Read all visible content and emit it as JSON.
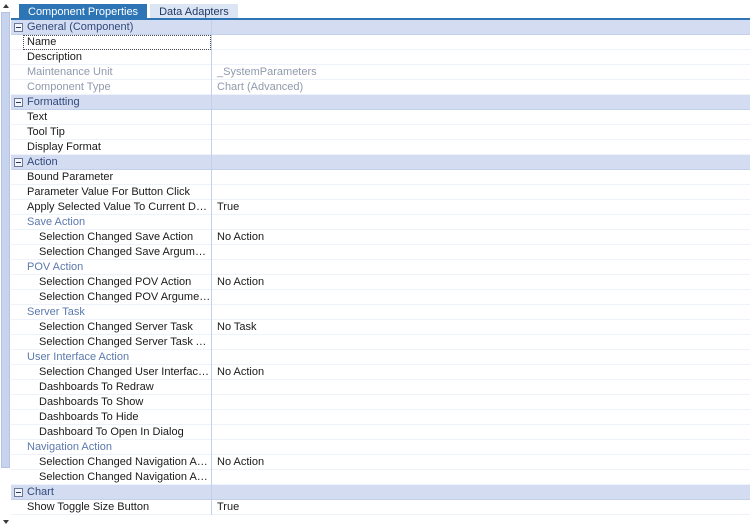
{
  "tabs": [
    {
      "label": "Component Properties",
      "active": true
    },
    {
      "label": "Data Adapters",
      "active": false
    }
  ],
  "scrollbar": {
    "up_arrow": "scroll-up-arrow",
    "down_arrow": "scroll-down-arrow"
  },
  "grid": {
    "rows": [
      {
        "type": "group",
        "label": "General (Component)",
        "value": "",
        "indent": 0,
        "expanded": true
      },
      {
        "type": "prop",
        "label": "Name",
        "value": "",
        "indent": 1,
        "focused": true
      },
      {
        "type": "prop",
        "label": "Description",
        "value": "",
        "indent": 1
      },
      {
        "type": "prop",
        "label": "Maintenance Unit",
        "value": "_SystemParameters",
        "indent": 1,
        "readonly": true
      },
      {
        "type": "prop",
        "label": "Component Type",
        "value": "Chart (Advanced)",
        "indent": 1,
        "readonly": true
      },
      {
        "type": "group",
        "label": "Formatting",
        "value": "",
        "indent": 0,
        "expanded": true
      },
      {
        "type": "prop",
        "label": "Text",
        "value": "",
        "indent": 1
      },
      {
        "type": "prop",
        "label": "Tool Tip",
        "value": "",
        "indent": 1
      },
      {
        "type": "prop",
        "label": "Display Format",
        "value": "",
        "indent": 1
      },
      {
        "type": "group",
        "label": "Action",
        "value": "",
        "indent": 0,
        "expanded": true
      },
      {
        "type": "prop",
        "label": "Bound Parameter",
        "value": "",
        "indent": 1
      },
      {
        "type": "prop",
        "label": "Parameter Value For Button Click",
        "value": "",
        "indent": 1
      },
      {
        "type": "prop",
        "label": "Apply Selected Value To Current Dashboard",
        "value": "True",
        "indent": 1
      },
      {
        "type": "subgroup",
        "label": "Save Action",
        "value": "",
        "indent": 1
      },
      {
        "type": "prop",
        "label": "Selection Changed Save Action",
        "value": "No Action",
        "indent": 2
      },
      {
        "type": "prop",
        "label": "Selection Changed Save Arguments",
        "value": "",
        "indent": 2
      },
      {
        "type": "subgroup",
        "label": "POV Action",
        "value": "",
        "indent": 1
      },
      {
        "type": "prop",
        "label": "Selection Changed POV Action",
        "value": "No Action",
        "indent": 2
      },
      {
        "type": "prop",
        "label": "Selection Changed POV Arguments",
        "value": "",
        "indent": 2
      },
      {
        "type": "subgroup",
        "label": "Server Task",
        "value": "",
        "indent": 1
      },
      {
        "type": "prop",
        "label": "Selection Changed Server Task",
        "value": "No Task",
        "indent": 2
      },
      {
        "type": "prop",
        "label": "Selection Changed Server Task Arguments",
        "value": "",
        "indent": 2
      },
      {
        "type": "subgroup",
        "label": "User Interface Action",
        "value": "",
        "indent": 1
      },
      {
        "type": "prop",
        "label": "Selection Changed User Interface Action",
        "value": "No Action",
        "indent": 2
      },
      {
        "type": "prop",
        "label": "Dashboards To Redraw",
        "value": "",
        "indent": 2
      },
      {
        "type": "prop",
        "label": "Dashboards To Show",
        "value": "",
        "indent": 2
      },
      {
        "type": "prop",
        "label": "Dashboards To Hide",
        "value": "",
        "indent": 2
      },
      {
        "type": "prop",
        "label": "Dashboard To Open In Dialog",
        "value": "",
        "indent": 2
      },
      {
        "type": "subgroup",
        "label": "Navigation Action",
        "value": "",
        "indent": 1
      },
      {
        "type": "prop",
        "label": "Selection Changed Navigation Action",
        "value": "No Action",
        "indent": 2
      },
      {
        "type": "prop",
        "label": "Selection Changed Navigation Arguments",
        "value": "",
        "indent": 2
      },
      {
        "type": "group",
        "label": "Chart",
        "value": "",
        "indent": 0,
        "expanded": true
      },
      {
        "type": "prop",
        "label": "Show Toggle Size Button",
        "value": "True",
        "indent": 1
      }
    ]
  },
  "colors": {
    "tab_active_bg": "#2e75b6",
    "tab_inactive_bg": "#dbe5f4",
    "group_header_bg": "#d3dcf1",
    "subgroup_text": "#5b79ad",
    "readonly_text": "#9099ad",
    "grid_line": "#eef2fa",
    "scroll_thumb": "#c8d4ee"
  }
}
